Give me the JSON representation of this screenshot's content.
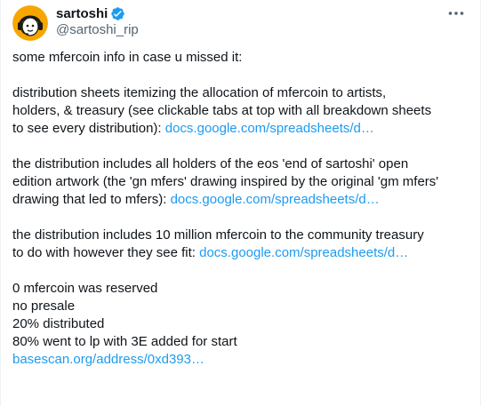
{
  "author": {
    "display_name": "sartoshi",
    "handle": "@sartoshi_rip",
    "verified": true
  },
  "menu": {
    "icon": "more-horizontal-icon"
  },
  "tweet": {
    "intro": "some mfercoin info in case u missed it:",
    "p1": {
      "line1": "distribution sheets itemizing the allocation of mfercoin to artists,",
      "line2": "holders, & treasury (see clickable tabs at top with all breakdown sheets",
      "line3_text": "to see every distribution): ",
      "line3_link": "docs.google.com/spreadsheets/d…"
    },
    "p2": {
      "line1": "the distribution includes all holders of the eos 'end of sartoshi' open",
      "line2": "edition artwork (the 'gn mfers' drawing inspired by the original 'gm mfers'",
      "line3_text": "drawing that led to mfers): ",
      "line3_link": "docs.google.com/spreadsheets/d…"
    },
    "p3": {
      "line1": "the distribution includes 10 million mfercoin to the community treasury",
      "line2_text": "to do with however they see fit: ",
      "line2_link": "docs.google.com/spreadsheets/d…"
    },
    "p4": {
      "line1": "0 mfercoin was reserved",
      "line2": "no presale",
      "line3": "20% distributed",
      "line4": "80% went to lp with 3E added for start",
      "line5_link": "basescan.org/address/0xd393…"
    }
  },
  "colors": {
    "text": "#0f1419",
    "secondary": "#536471",
    "link": "#1d9bf0",
    "verified": "#1d9bf0",
    "avatar_bg": "#f7a600"
  }
}
